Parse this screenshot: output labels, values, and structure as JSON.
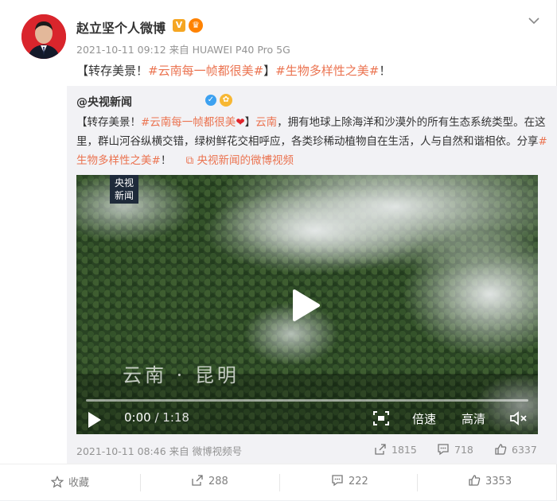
{
  "author": {
    "name": "赵立坚个人微博",
    "v_badge": "V",
    "crown_badge": "👑"
  },
  "post": {
    "meta": "2021-10-11 09:12 来自 HUAWEI P40 Pro 5G",
    "text_prefix": "【转存美景！",
    "hashtag1": "#云南每一帧都很美#",
    "text_mid": "】",
    "hashtag2": "#生物多样性之美#",
    "text_suffix": "！"
  },
  "repost": {
    "user": "@央视新闻",
    "line1_prefix": "【转存美景！",
    "hashtag1": "#云南每一帧都很美",
    "heart": "❤",
    "line1_mid": "】",
    "location_link": "云南",
    "line1_rest": "，拥有地球上除海洋和沙漠外的所有生态系统类型。在这里，群山河谷纵横交错，绿树鲜花交相呼应，各类珍稀动植物自在生活，人与自然和谐相依。分享",
    "hashtag2": "#生物多样性之美#",
    "after_hashtag2": "！",
    "video_link": "央视新闻的微博视频",
    "meta": "2021-10-11 08:46 来自 微博视频号",
    "stats": {
      "reposts": "1815",
      "comments": "718",
      "likes": "6337"
    }
  },
  "video": {
    "logo_line1": "央视",
    "logo_line2": "新闻",
    "caption": "云南 · 昆明",
    "time_current": "0:00",
    "time_total": "/ 1:18",
    "speed_label": "倍速",
    "quality_label": "高清",
    "progress_fraction": 0.0
  },
  "actions": {
    "favorite": "收藏",
    "repost": "288",
    "comment": "222",
    "like": "3353"
  },
  "colors": {
    "link": "#eb7350",
    "meta": "#939393"
  }
}
